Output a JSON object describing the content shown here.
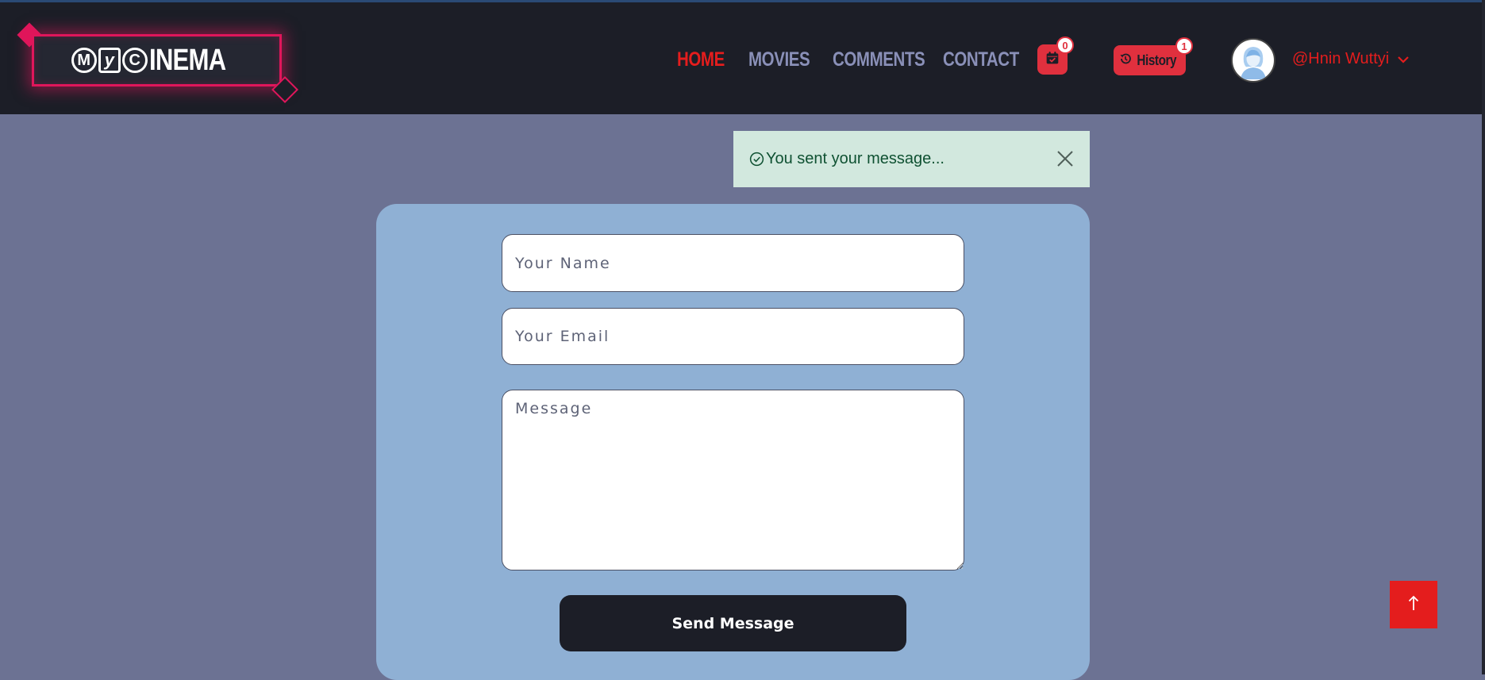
{
  "logo": {
    "letter_1": "M",
    "letter_2": "y",
    "letter_3": "C",
    "text": "INEMA"
  },
  "nav": {
    "items": [
      {
        "label": "HOME",
        "active": true
      },
      {
        "label": "MOVIES",
        "active": false
      },
      {
        "label": "COMMENTS",
        "active": false
      },
      {
        "label": "CONTACT",
        "active": false
      }
    ]
  },
  "booking": {
    "icon": "calendar-check-icon",
    "count": "0"
  },
  "history": {
    "label": "History",
    "icon": "history-icon",
    "count": "1"
  },
  "user": {
    "name": "@Hnin Wuttyi",
    "avatar": "woman-avatar"
  },
  "alert": {
    "message": "You sent your message...",
    "icon": "check-circle-icon"
  },
  "form": {
    "name_placeholder": "Your Name",
    "email_placeholder": "Your Email",
    "message_placeholder": "Message",
    "submit_label": "Send Message"
  },
  "colors": {
    "accent_red": "#e41d1d",
    "header_bg": "#1c1e27",
    "page_bg": "#6c7293",
    "card_bg": "#8fb0d4",
    "alert_bg": "#d2e8de",
    "logo_neon": "#e0165b"
  }
}
